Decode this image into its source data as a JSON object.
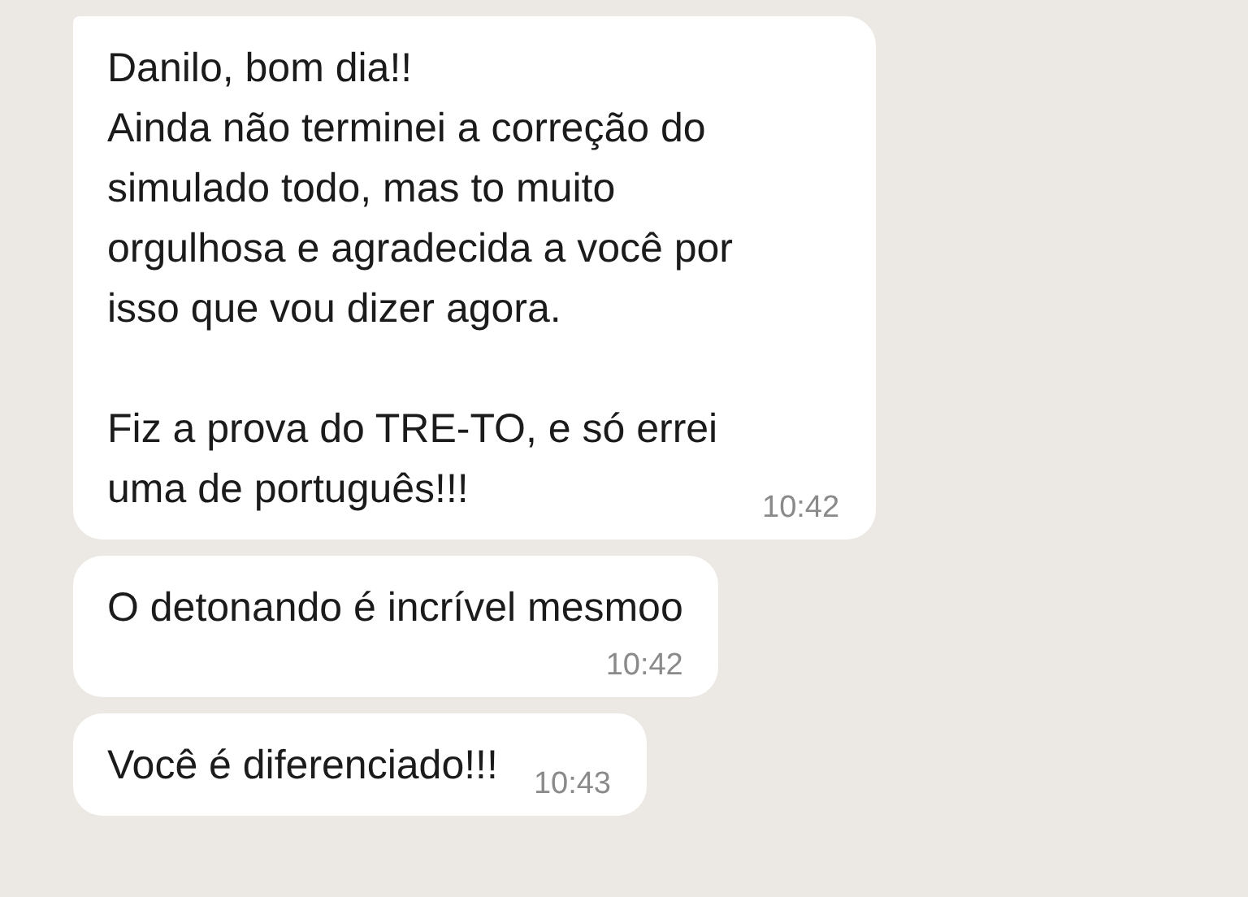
{
  "messages": [
    {
      "text": "Danilo, bom dia!!\nAinda não terminei a correção do\nsimulado todo, mas to muito\norgulhosa e agradecida a você por\nisso que vou dizer agora.\n\nFiz a prova do TRE-TO, e só errei\numa de português!!!",
      "time": "10:42"
    },
    {
      "text": "O detonando é incrível mesmoo",
      "time": "10:42"
    },
    {
      "text": "Você é diferenciado!!!",
      "time": "10:43"
    }
  ]
}
